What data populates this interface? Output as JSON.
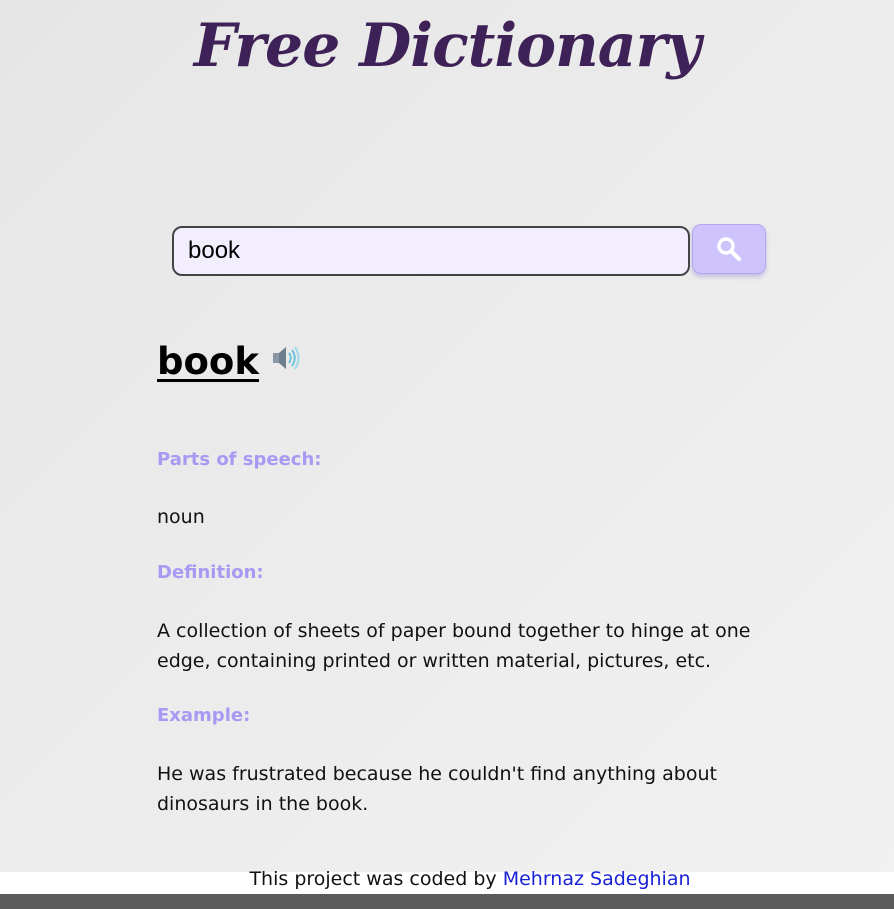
{
  "header": {
    "title": "Free Dictionary"
  },
  "search": {
    "value": "book",
    "icon": "search-icon"
  },
  "result": {
    "word": "book",
    "audio_icon": "speaker-icon",
    "parts_of_speech_label": "Parts of speech:",
    "part_of_speech": "noun",
    "definition_label": "Definition:",
    "definition": "A collection of sheets of paper bound together to hinge at one edge, containing printed or written material, pictures, etc.",
    "example_label": "Example:",
    "example": "He was frustrated because he couldn't find anything about dinosaurs in the book."
  },
  "footer": {
    "prefix": "This project was coded by",
    "author_link": "Mehrnaz Sadeghian"
  },
  "colors": {
    "title": "#3e2257",
    "label": "#a899f2",
    "button": "#cec3fd",
    "input_bg": "#f3eefe",
    "link": "#1a22d6"
  }
}
